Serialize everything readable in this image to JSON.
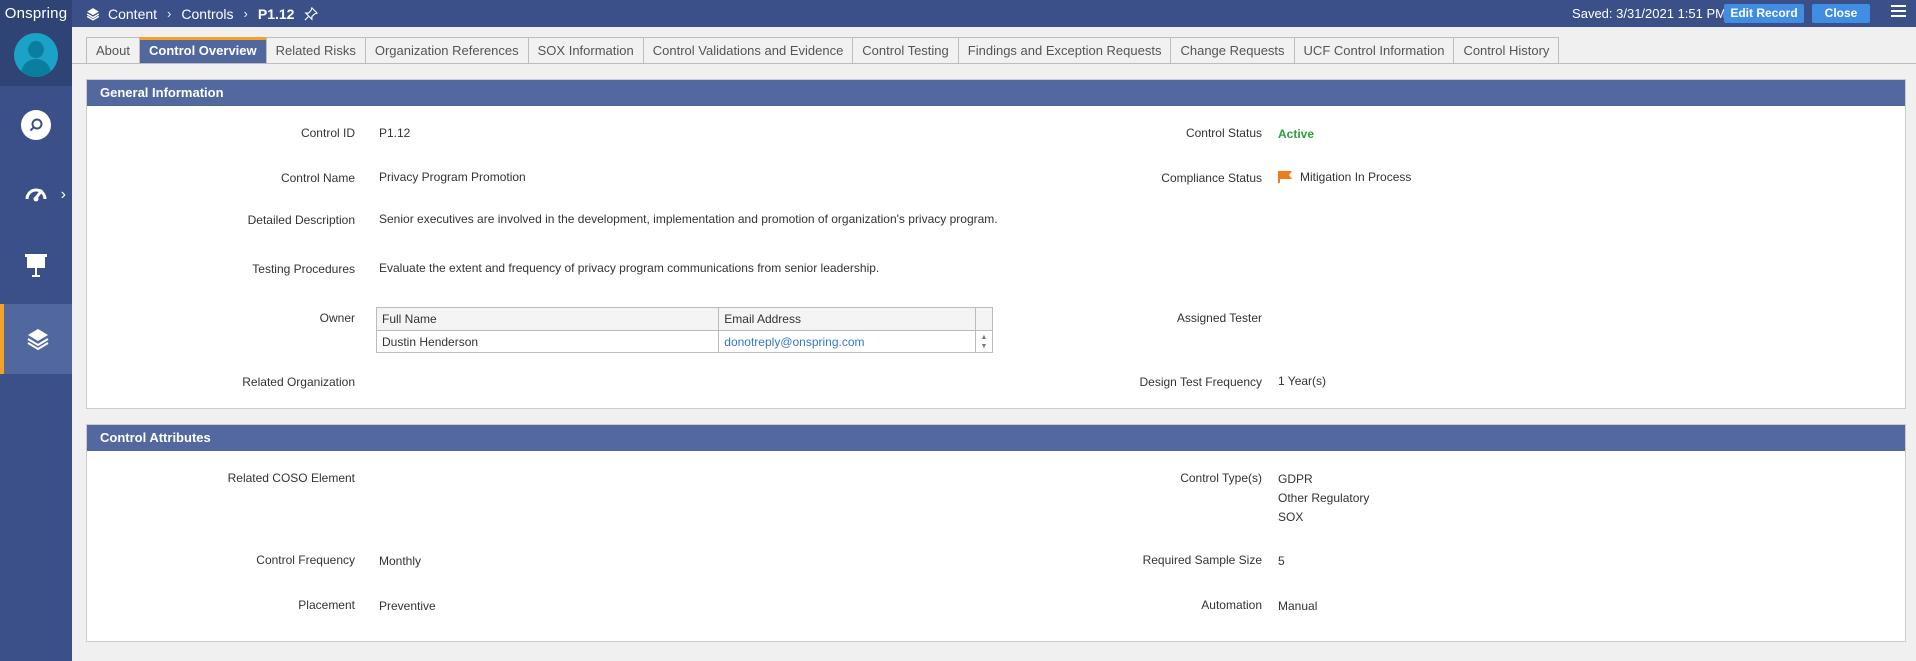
{
  "app": {
    "brand": "Onspring"
  },
  "breadcrumb": {
    "items": [
      "Content",
      "Controls",
      "P1.12"
    ]
  },
  "header": {
    "saved_text": "Saved: 3/31/2021 1:51 PM",
    "edit_label": "Edit Record",
    "close_label": "Close"
  },
  "tabs": [
    {
      "label": "About"
    },
    {
      "label": "Control Overview",
      "active": true
    },
    {
      "label": "Related Risks"
    },
    {
      "label": "Organization References"
    },
    {
      "label": "SOX Information"
    },
    {
      "label": "Control Validations and Evidence"
    },
    {
      "label": "Control Testing"
    },
    {
      "label": "Findings and Exception Requests"
    },
    {
      "label": "Change Requests"
    },
    {
      "label": "UCF Control Information"
    },
    {
      "label": "Control History"
    }
  ],
  "general": {
    "title": "General Information",
    "control_id_label": "Control ID",
    "control_id": "P1.12",
    "control_name_label": "Control Name",
    "control_name": "Privacy Program Promotion",
    "detailed_description_label": "Detailed Description",
    "detailed_description": "Senior executives are involved in the development, implementation and promotion of organization's privacy program.",
    "testing_procedures_label": "Testing Procedures",
    "testing_procedures": "Evaluate the extent and frequency of privacy program communications from senior leadership.",
    "owner_label": "Owner",
    "owner_table": {
      "columns": [
        "Full Name",
        "Email Address"
      ],
      "rows": [
        {
          "name": "Dustin Henderson",
          "email": "donotreply@onspring.com"
        }
      ]
    },
    "related_org_label": "Related Organization",
    "control_status_label": "Control Status",
    "control_status": "Active",
    "compliance_status_label": "Compliance Status",
    "compliance_status": "Mitigation In Process",
    "assigned_tester_label": "Assigned Tester",
    "design_freq_label": "Design Test Frequency",
    "design_freq": "1 Year(s)"
  },
  "attributes": {
    "title": "Control Attributes",
    "coso_label": "Related COSO Element",
    "control_freq_label": "Control Frequency",
    "control_freq": "Monthly",
    "placement_label": "Placement",
    "placement": "Preventive",
    "control_types_label": "Control Type(s)",
    "control_types": [
      "GDPR",
      "Other Regulatory",
      "SOX"
    ],
    "sample_size_label": "Required Sample Size",
    "sample_size": "5",
    "automation_label": "Automation",
    "automation": "Manual"
  },
  "colors": {
    "nav": "#3b5088",
    "header": "#52689f",
    "accent": "#f5a027",
    "button": "#3f8ee3",
    "active_status": "#2aa13b",
    "flag": "#f07d1a"
  },
  "icons": [
    "layers-icon",
    "search-icon",
    "dashboard-icon",
    "presentation-icon",
    "pin-icon",
    "flag-icon",
    "menu-icon"
  ]
}
